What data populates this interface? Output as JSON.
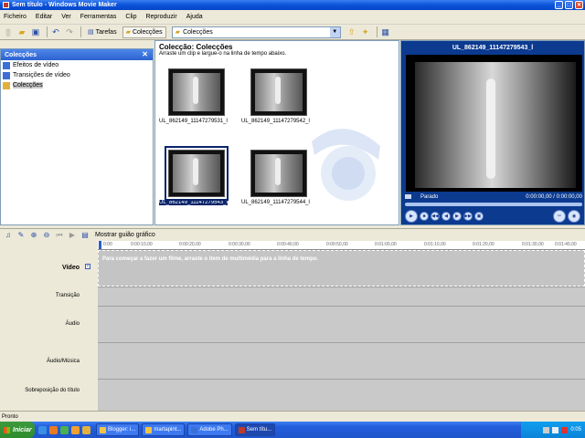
{
  "window": {
    "title": "Sem título - Windows Movie Maker"
  },
  "menu": [
    "Ficheiro",
    "Editar",
    "Ver",
    "Ferramentas",
    "Clip",
    "Reproduzir",
    "Ajuda"
  ],
  "toolbar": {
    "tasks_label": "Tarefas",
    "collections_label": "Colecções",
    "collection_dropdown": "Colecções"
  },
  "left_pane": {
    "title": "Colecções",
    "items": [
      {
        "label": "Efeitos de vídeo",
        "icon": "video-effects-icon"
      },
      {
        "label": "Transições de vídeo",
        "icon": "video-transitions-icon"
      },
      {
        "label": "Colecções",
        "icon": "collections-folder-icon"
      }
    ]
  },
  "collection": {
    "title": "Colecção: Colecções",
    "subtitle": "Arraste um clip e largue-o na linha de tempo abaixo.",
    "clips": [
      {
        "label": "UL_862149_11147279531_l"
      },
      {
        "label": "UL_862149_11147279542_l"
      },
      {
        "label": "UL_862149_11147279543_l"
      },
      {
        "label": "UL_862149_11147279544_l"
      }
    ]
  },
  "preview": {
    "title": "UL_862149_11147279543_l",
    "status": "Parado",
    "time": "0:00:00,00 / 0:00:00,00"
  },
  "timeline": {
    "show_label": "Mostrar guião gráfico",
    "ruler": [
      "0:00",
      "0:00:10,00",
      "0:00:20,00",
      "0:00:30,00",
      "0:00:40,00",
      "0:00:50,00",
      "0:01:00,00",
      "0:01:10,00",
      "0:01:20,00",
      "0:01:30,00",
      "0:01:40,00"
    ],
    "tracks": {
      "video": "Vídeo",
      "transition": "Transição",
      "audio": "Áudio",
      "audio_music": "Áudio/Música",
      "title_overlay": "Sobreposição do título"
    },
    "hint": "Para começar a fazer um filme, arraste o item de multimédia para a linha de tempo."
  },
  "status": {
    "text": "Pronto"
  },
  "taskbar": {
    "start": "Iniciar",
    "tasks": [
      {
        "label": "Blogger: i..."
      },
      {
        "label": "martapint..."
      },
      {
        "label": "Adobe Ph..."
      },
      {
        "label": "Sem títu..."
      }
    ],
    "clock": "0:05"
  }
}
